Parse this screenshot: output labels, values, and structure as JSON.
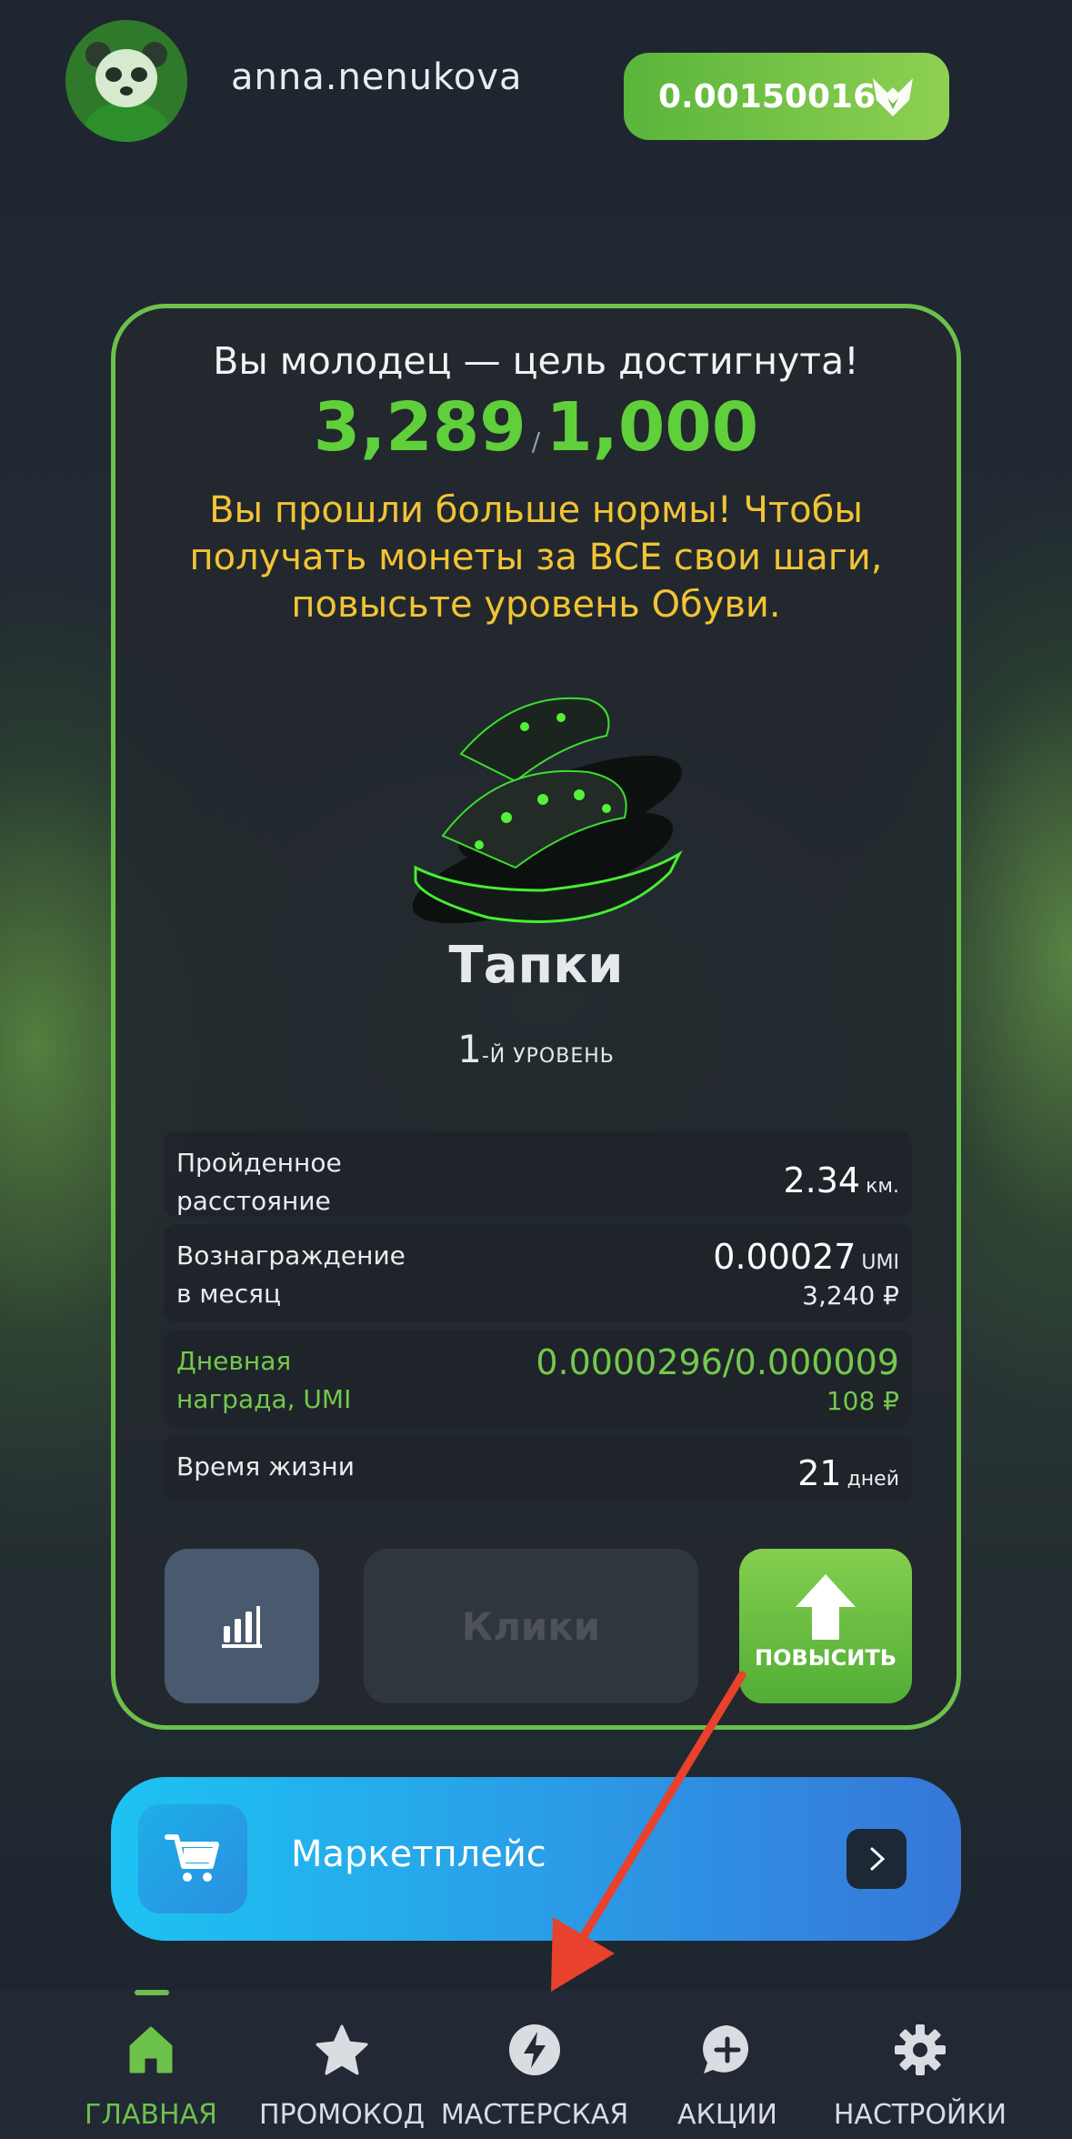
{
  "header": {
    "username": "anna.nenukova",
    "balance": "0.00150016"
  },
  "goal": {
    "title": "Вы молодец — цель достигнута!",
    "steps": "3,289",
    "goal_steps": "1,000",
    "warning": "Вы прошли больше нормы! Чтобы получать монеты за ВСЕ свои шаги, повысьте уровень Обуви."
  },
  "shoe": {
    "name": "Тапки",
    "level_num": "1",
    "level_suffix": "-Й УРОВЕНЬ"
  },
  "stats": {
    "distance_label": "Пройденное расстояние",
    "distance_value": "2.34",
    "distance_unit": "км.",
    "reward_label": "Вознаграждение в месяц",
    "reward_value": "0.00027",
    "reward_unit": "UMI",
    "reward_rub": "3,240 ₽",
    "daily_label": "Дневная награда, UMI",
    "daily_value": "0.0000296/0.000009",
    "daily_rub": "108 ₽",
    "life_label": "Время жизни",
    "life_value": "21",
    "life_unit": "дней"
  },
  "actions": {
    "clicks_label": "Клики",
    "upgrade_label": "ПОВЫСИТЬ"
  },
  "market": {
    "label": "Маркетплейс"
  },
  "nav": [
    {
      "label": "ГЛАВНАЯ",
      "icon": "home-icon"
    },
    {
      "label": "ПРОМОКОД",
      "icon": "star-icon"
    },
    {
      "label": "МАСТЕРСКАЯ",
      "icon": "lightning-icon"
    },
    {
      "label": "АКЦИИ",
      "icon": "chat-plus-icon"
    },
    {
      "label": "НАСТРОЙКИ",
      "icon": "gear-icon"
    }
  ],
  "colors": {
    "accent_green": "#6cc14a",
    "warning_yellow": "#f2c334",
    "annotation_arrow": "#e8412c"
  }
}
